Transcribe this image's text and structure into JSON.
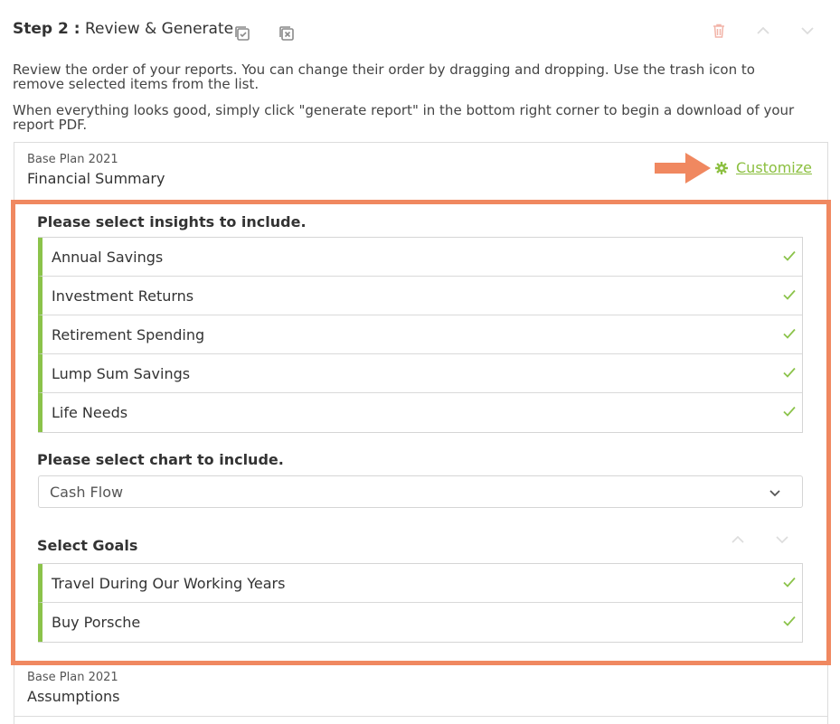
{
  "header": {
    "step_prefix": "Step 2 :",
    "step_title": "Review & Generate",
    "icons": [
      "select-all-icon",
      "deselect-all-icon",
      "trash-icon",
      "chevron-up-icon",
      "chevron-down-icon"
    ]
  },
  "description": {
    "line1": "Review the order of your reports. You can change their order by dragging and dropping. Use the trash icon to remove selected items from the list.",
    "line2": "When everything looks good, simply click \"generate report\" in the bottom right corner to begin a download of your report PDF."
  },
  "report_1": {
    "plan": "Base Plan 2021",
    "name": "Financial Summary",
    "customize_label": "Customize"
  },
  "insights": {
    "title": "Please select insights to include.",
    "items": [
      "Annual Savings",
      "Investment Returns",
      "Retirement Spending",
      "Lump Sum Savings",
      "Life Needs"
    ]
  },
  "chart_select": {
    "title": "Please select chart to include.",
    "value": "Cash Flow"
  },
  "goals": {
    "title": "Select Goals",
    "items": [
      "Travel During Our Working Years",
      "Buy Porsche"
    ]
  },
  "report_2": {
    "plan": "Base Plan 2021",
    "name": "Assumptions"
  },
  "colors": {
    "accent_green": "#8bc34a",
    "highlight_orange": "#f08860",
    "link_green": "#8bbf3f"
  }
}
